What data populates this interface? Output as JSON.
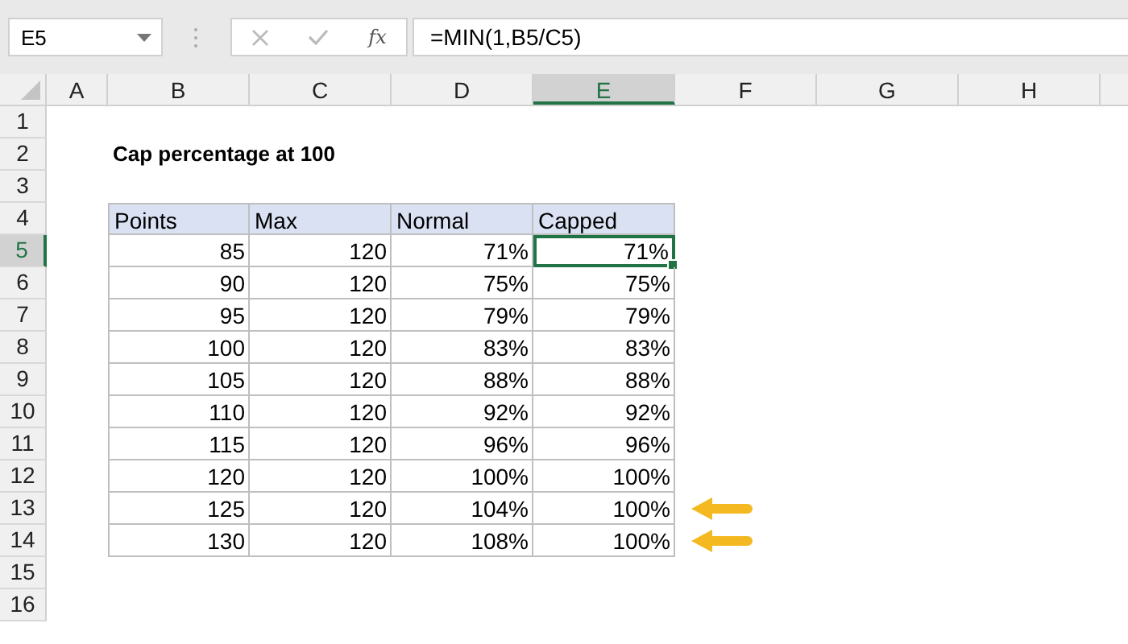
{
  "name_box": "E5",
  "function_symbol": "fx",
  "formula": "=MIN(1,B5/C5)",
  "columns": [
    {
      "label": "A",
      "selected": false
    },
    {
      "label": "B",
      "selected": false
    },
    {
      "label": "C",
      "selected": false
    },
    {
      "label": "D",
      "selected": false
    },
    {
      "label": "E",
      "selected": true
    },
    {
      "label": "F",
      "selected": false
    },
    {
      "label": "G",
      "selected": false
    },
    {
      "label": "H",
      "selected": false
    }
  ],
  "row_numbers": [
    {
      "label": "1",
      "selected": false
    },
    {
      "label": "2",
      "selected": false
    },
    {
      "label": "3",
      "selected": false
    },
    {
      "label": "4",
      "selected": false
    },
    {
      "label": "5",
      "selected": true
    },
    {
      "label": "6",
      "selected": false
    },
    {
      "label": "7",
      "selected": false
    },
    {
      "label": "8",
      "selected": false
    },
    {
      "label": "9",
      "selected": false
    },
    {
      "label": "10",
      "selected": false
    },
    {
      "label": "11",
      "selected": false
    },
    {
      "label": "12",
      "selected": false
    },
    {
      "label": "13",
      "selected": false
    },
    {
      "label": "14",
      "selected": false
    },
    {
      "label": "15",
      "selected": false
    },
    {
      "label": "16",
      "selected": false
    }
  ],
  "title": "Cap percentage at 100",
  "table": {
    "columns": [
      "Points",
      "Max",
      "Normal",
      "Capped"
    ],
    "rows": [
      {
        "cells": [
          {
            "text": "85",
            "selected": false
          },
          {
            "text": "120",
            "selected": false
          },
          {
            "text": "71%",
            "selected": false
          },
          {
            "text": "71%",
            "selected": true
          }
        ],
        "flagged": false
      },
      {
        "cells": [
          {
            "text": "90",
            "selected": false
          },
          {
            "text": "120",
            "selected": false
          },
          {
            "text": "75%",
            "selected": false
          },
          {
            "text": "75%",
            "selected": false
          }
        ],
        "flagged": false
      },
      {
        "cells": [
          {
            "text": "95",
            "selected": false
          },
          {
            "text": "120",
            "selected": false
          },
          {
            "text": "79%",
            "selected": false
          },
          {
            "text": "79%",
            "selected": false
          }
        ],
        "flagged": false
      },
      {
        "cells": [
          {
            "text": "100",
            "selected": false
          },
          {
            "text": "120",
            "selected": false
          },
          {
            "text": "83%",
            "selected": false
          },
          {
            "text": "83%",
            "selected": false
          }
        ],
        "flagged": false
      },
      {
        "cells": [
          {
            "text": "105",
            "selected": false
          },
          {
            "text": "120",
            "selected": false
          },
          {
            "text": "88%",
            "selected": false
          },
          {
            "text": "88%",
            "selected": false
          }
        ],
        "flagged": false
      },
      {
        "cells": [
          {
            "text": "110",
            "selected": false
          },
          {
            "text": "120",
            "selected": false
          },
          {
            "text": "92%",
            "selected": false
          },
          {
            "text": "92%",
            "selected": false
          }
        ],
        "flagged": false
      },
      {
        "cells": [
          {
            "text": "115",
            "selected": false
          },
          {
            "text": "120",
            "selected": false
          },
          {
            "text": "96%",
            "selected": false
          },
          {
            "text": "96%",
            "selected": false
          }
        ],
        "flagged": false
      },
      {
        "cells": [
          {
            "text": "120",
            "selected": false
          },
          {
            "text": "120",
            "selected": false
          },
          {
            "text": "100%",
            "selected": false
          },
          {
            "text": "100%",
            "selected": false
          }
        ],
        "flagged": false
      },
      {
        "cells": [
          {
            "text": "125",
            "selected": false
          },
          {
            "text": "120",
            "selected": false
          },
          {
            "text": "104%",
            "selected": false
          },
          {
            "text": "100%",
            "selected": false
          }
        ],
        "flagged": true
      },
      {
        "cells": [
          {
            "text": "130",
            "selected": false
          },
          {
            "text": "120",
            "selected": false
          },
          {
            "text": "108%",
            "selected": false
          },
          {
            "text": "100%",
            "selected": false
          }
        ],
        "flagged": true
      }
    ]
  }
}
